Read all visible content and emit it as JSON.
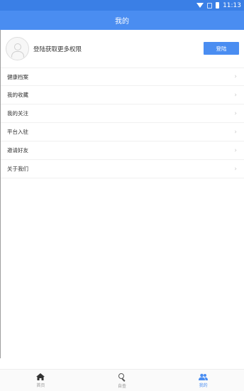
{
  "status_bar": {
    "time": "11:13"
  },
  "header": {
    "title": "我的"
  },
  "profile": {
    "prompt": "登陆获取更多权限",
    "login_label": "登陆"
  },
  "menu": {
    "items": [
      {
        "label": "健康档案",
        "icon": "chevron-right-icon"
      },
      {
        "label": "我的收藏",
        "icon": "chevron-right-icon"
      },
      {
        "label": "我的关注",
        "icon": "chevron-right-icon"
      },
      {
        "label": "平台入驻",
        "icon": "chevron-right-icon"
      },
      {
        "label": "邀请好友",
        "icon": "chevron-right-icon"
      },
      {
        "label": "关于我们",
        "icon": "chevron-right-icon"
      }
    ]
  },
  "tab_bar": {
    "tabs": [
      {
        "label": "首页",
        "icon": "home-icon"
      },
      {
        "label": "自查",
        "icon": "search-icon"
      },
      {
        "label": "我的",
        "icon": "people-icon",
        "active": true
      }
    ]
  },
  "colors": {
    "primary": "#4a8df1",
    "status_bar": "#3a7fe6"
  }
}
